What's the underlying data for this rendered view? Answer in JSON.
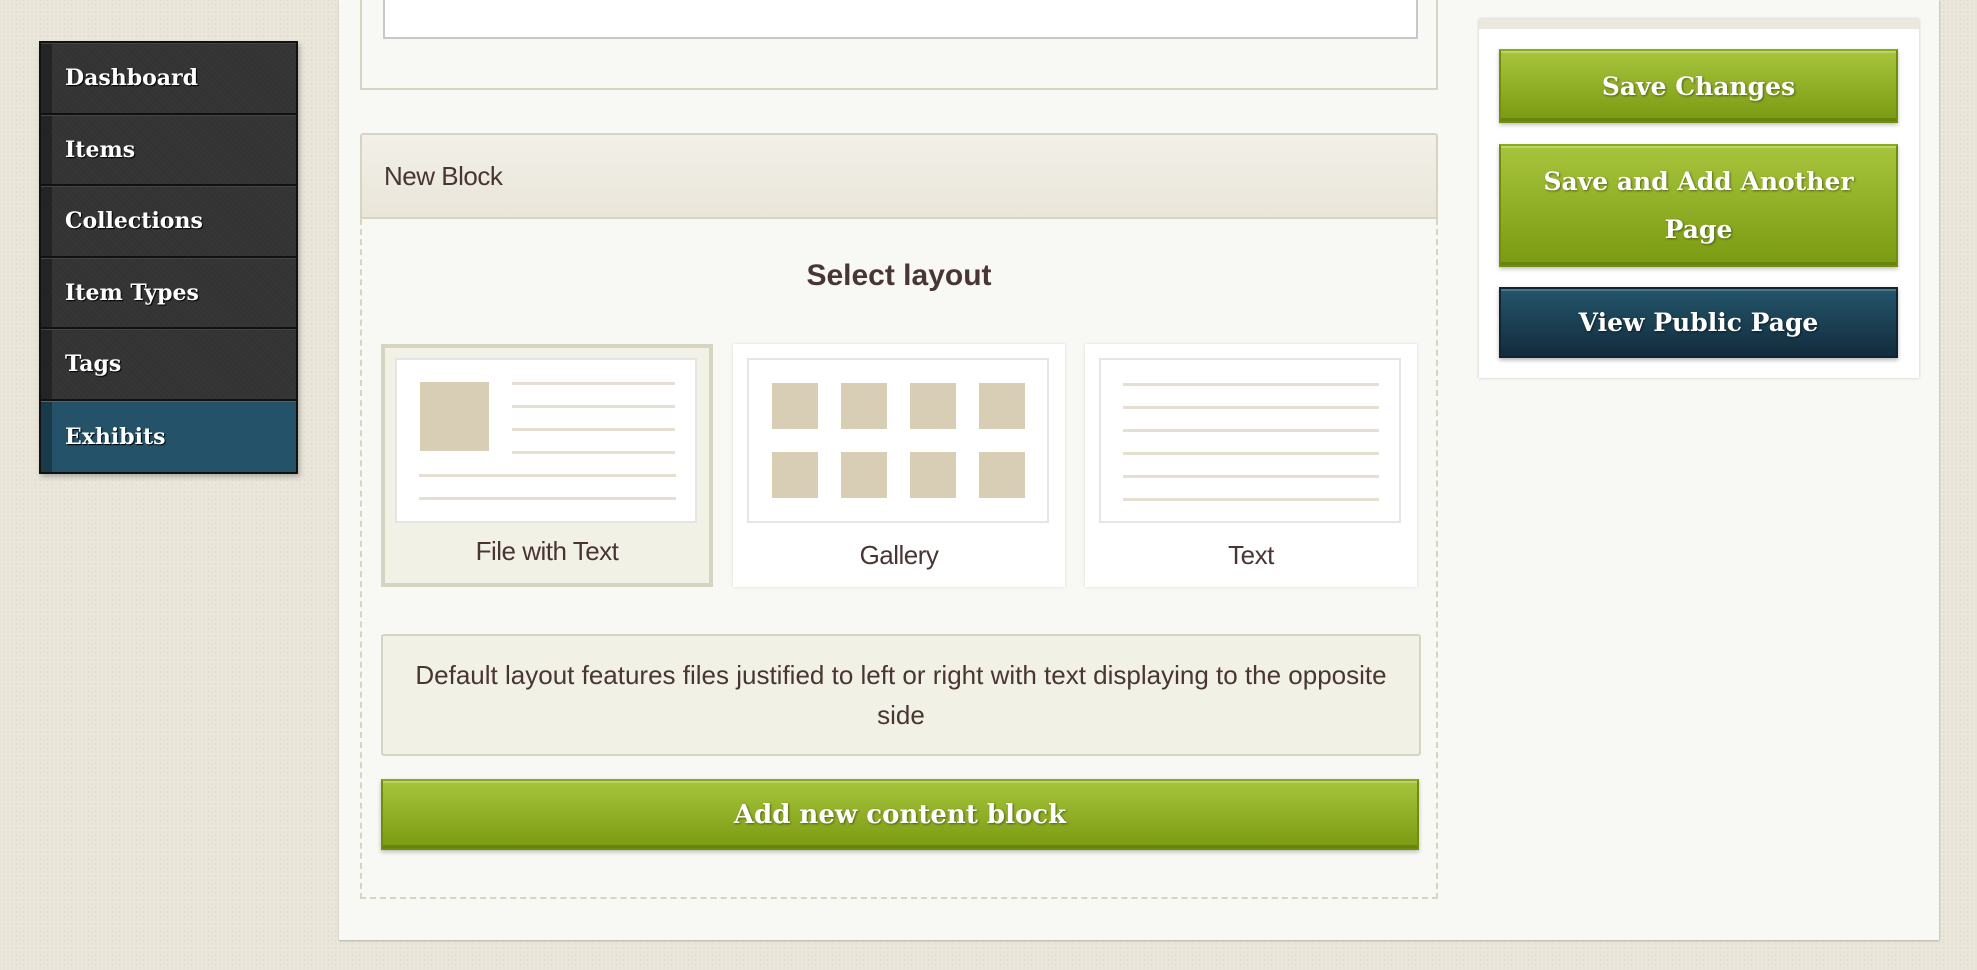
{
  "sidebar": {
    "items": [
      {
        "label": "Dashboard",
        "active": false
      },
      {
        "label": "Items",
        "active": false
      },
      {
        "label": "Collections",
        "active": false
      },
      {
        "label": "Item Types",
        "active": false
      },
      {
        "label": "Tags",
        "active": false
      },
      {
        "label": "Exhibits",
        "active": true
      }
    ]
  },
  "block": {
    "header": "New Block",
    "select_heading": "Select layout",
    "layouts": [
      {
        "label": "File with Text",
        "icon": "file-with-text-layout-icon",
        "selected": true
      },
      {
        "label": "Gallery",
        "icon": "gallery-layout-icon",
        "selected": false
      },
      {
        "label": "Text",
        "icon": "text-layout-icon",
        "selected": false
      }
    ],
    "description": "Default layout features files justified to left or right with text displaying to the opposite side",
    "add_button": "Add new content block"
  },
  "actions": {
    "save": "Save Changes",
    "save_add": "Save and Add Another Page",
    "view_public": "View Public Page"
  },
  "colors": {
    "sidebar_active": "#245369",
    "sidebar_bg": "#333333",
    "button_green": "#8bad22",
    "button_blue": "#1b3f52",
    "text": "#4a3535",
    "thumb_fill": "#d8cdb5"
  }
}
